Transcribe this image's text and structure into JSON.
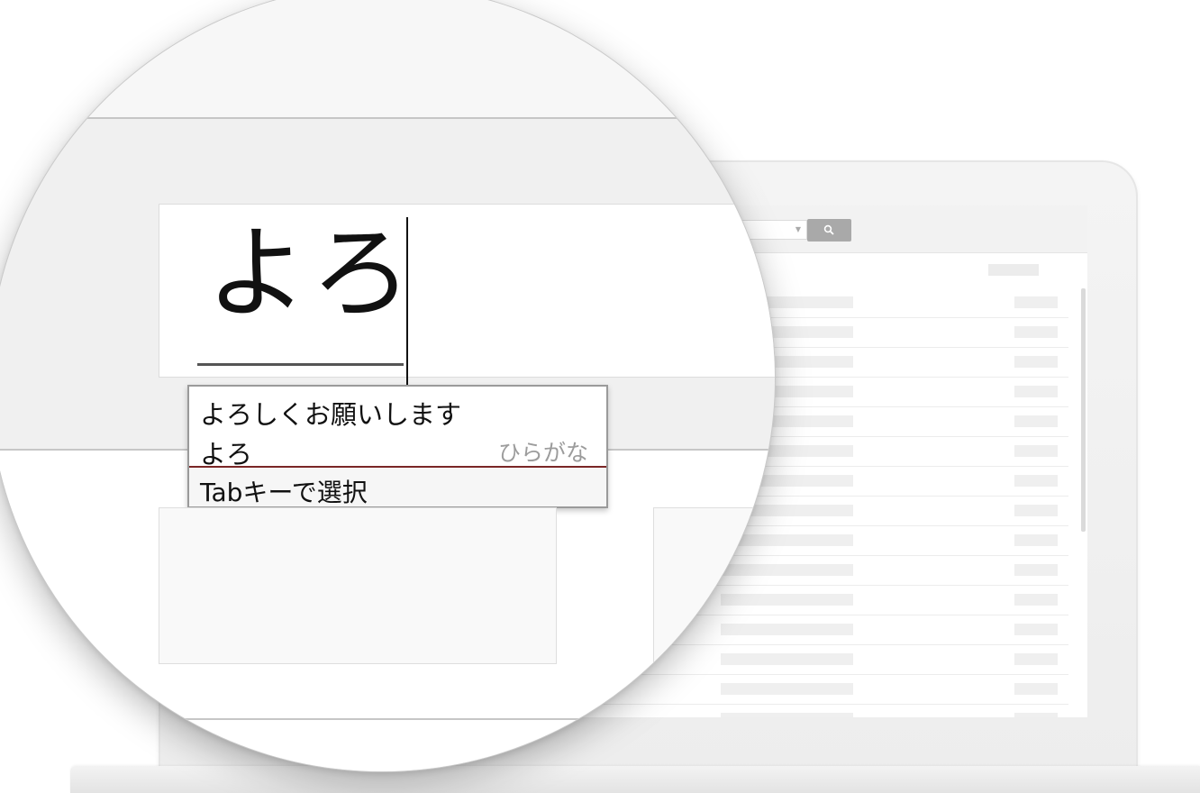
{
  "ime": {
    "composition": "よろ",
    "candidates": [
      {
        "text": "よろしくお願いします",
        "hint": ""
      },
      {
        "text": "よろ",
        "hint": "ひらがな"
      }
    ],
    "footer": "Tabキーで選択"
  },
  "background_app": {
    "search_button_icon": "search-icon",
    "row_count": 15
  },
  "colors": {
    "candidate_divider": "#7a2626",
    "search_button": "#a9a9a9"
  }
}
